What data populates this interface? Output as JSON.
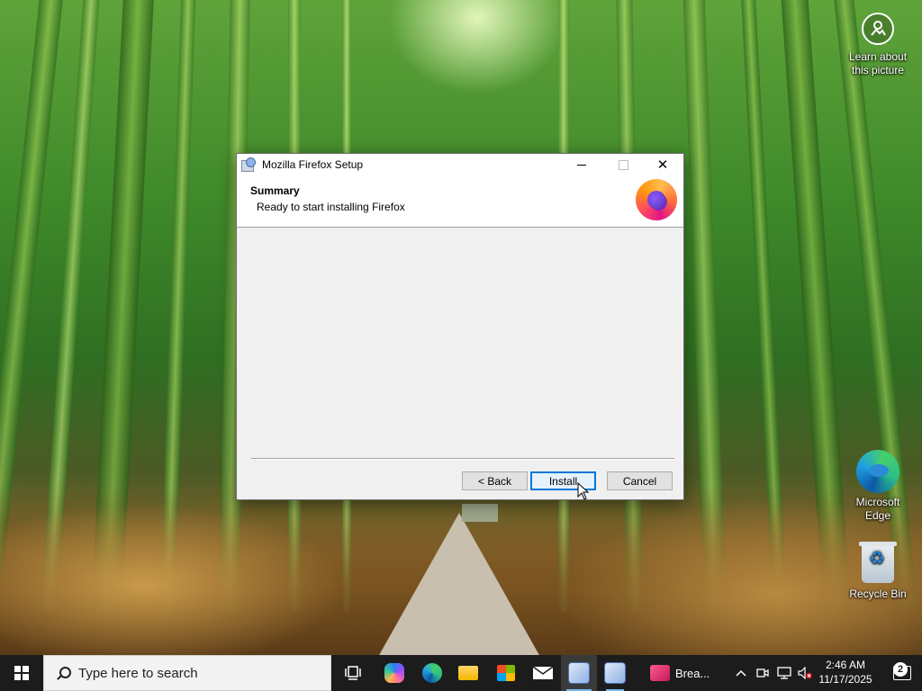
{
  "desktop": {
    "learn_about": "Learn about this picture",
    "icons": [
      {
        "label": "Microsoft Edge"
      },
      {
        "label": "Recycle Bin"
      }
    ]
  },
  "window": {
    "title": "Mozilla Firefox Setup",
    "header_title": "Summary",
    "header_subtitle": "Ready to start installing Firefox",
    "buttons": {
      "back": "< Back",
      "install": "Install",
      "cancel": "Cancel"
    }
  },
  "taskbar": {
    "search_placeholder": "Type here to search",
    "apps": [
      {
        "name": "task-view",
        "icon": "task-view-icon"
      },
      {
        "name": "copilot",
        "icon": "copilot-icon"
      },
      {
        "name": "edge",
        "icon": "edge-icon"
      },
      {
        "name": "file-explorer",
        "icon": "folder-icon"
      },
      {
        "name": "store",
        "icon": "store-icon"
      },
      {
        "name": "mail",
        "icon": "mail-icon"
      },
      {
        "name": "setup-1",
        "icon": "installer-icon"
      },
      {
        "name": "setup-2",
        "icon": "installer-icon"
      },
      {
        "name": "break",
        "icon": "break-app-icon",
        "label": "Brea..."
      }
    ],
    "clock": {
      "time": "2:46 AM",
      "date": "11/17/2025"
    },
    "notification_count": "2"
  },
  "colors": {
    "accent": "#0078d7",
    "taskbar_bg": "#1c1c1c"
  }
}
